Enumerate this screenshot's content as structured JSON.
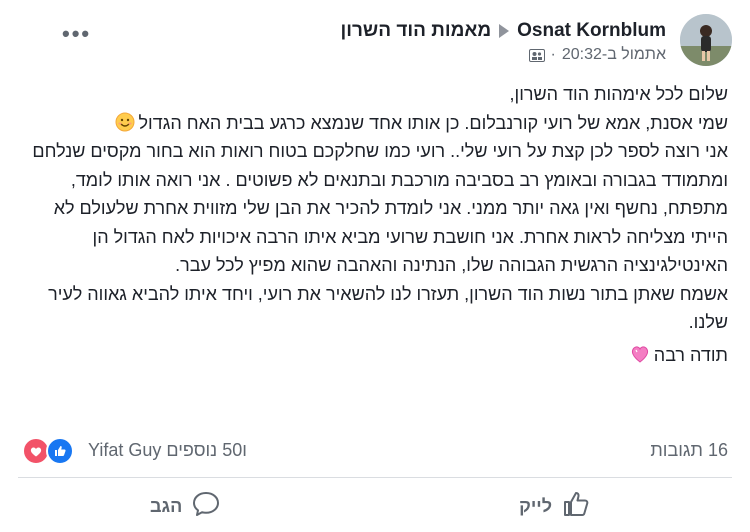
{
  "post": {
    "author": "Osnat Kornblum",
    "group": "מאמות הוד השרון",
    "timestamp": "אתמול ב-20:32",
    "separator": "·",
    "more": "•••",
    "paragraphs": [
      "שלום לכל אימהות הוד השרון,",
      "שמי אסנת, אמא של רועי קורנבלום. כן אותו אחד שנמצא כרגע בבית האח הגדול",
      "אני רוצה לספר לכן קצת על רועי שלי.. רועי כמו שחלקכם בטוח רואות הוא בחור  מקסים שנלחם ומתמודד בגבורה ובאומץ רב בסביבה מורכבת ובתנאים לא פשוטים . אני רואה אותו לומד, מתפתח, נחשף ואין גאה יותר ממני. אני לומדת להכיר את הבן שלי מזווית אחרת שלעולם לא הייתי מצליחה לראות אחרת. אני חושבת שרועי מביא איתו הרבה איכויות לאח הגדול הן האינטילגינציה הרגשית הגבוהה שלו, הנתינה והאהבה שהוא מפיץ לכל עבר.",
      "אשמח שאתן בתור נשות הוד השרון, תעזרו לנו להשאיר את רועי, ויחד איתו להביא גאווה לעיר שלנו.",
      "תודה רבה"
    ]
  },
  "reactions": {
    "summary": "Yifat Guy ו50 נוספים",
    "comments": "16 תגובות"
  },
  "actions": {
    "like": "לייק",
    "comment": "הגב"
  },
  "colors": {
    "like_blue": "#1877f2",
    "heart_red": "#f25268",
    "muted": "#606770"
  },
  "icons": {
    "emoji_1": "smiling-face-emoji",
    "emoji_2": "sparkling-heart-emoji"
  }
}
